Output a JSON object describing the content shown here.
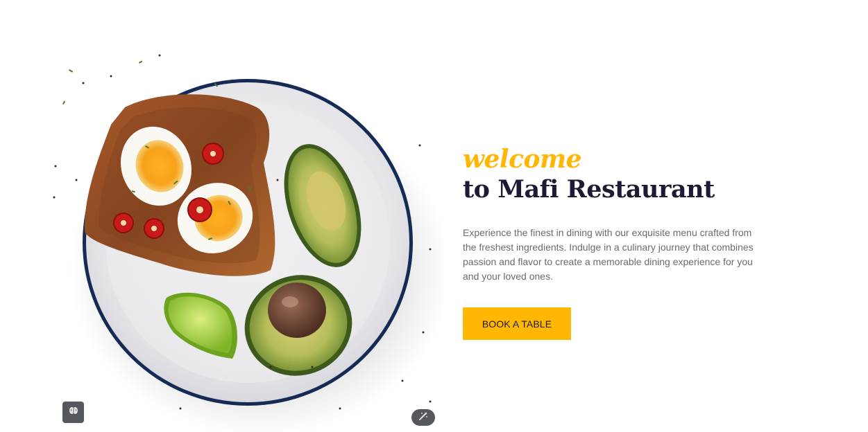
{
  "hero": {
    "welcome": "welcome",
    "title": "to Mafi Restaurant",
    "description": "Experience the finest in dining with our exquisite menu crafted from the freshest ingredients. Indulge in a culinary journey that combines passion and flavor to create a memorable dining experience for you and your loved ones.",
    "button_label": "BOOK A TABLE"
  },
  "colors": {
    "accent": "#ffb703",
    "title": "#1b1b33",
    "text": "#6b6b6b",
    "widget": "#55595e"
  },
  "icons": {
    "left_widget": "brain-icon",
    "right_widget": "magic-wand-icon"
  }
}
